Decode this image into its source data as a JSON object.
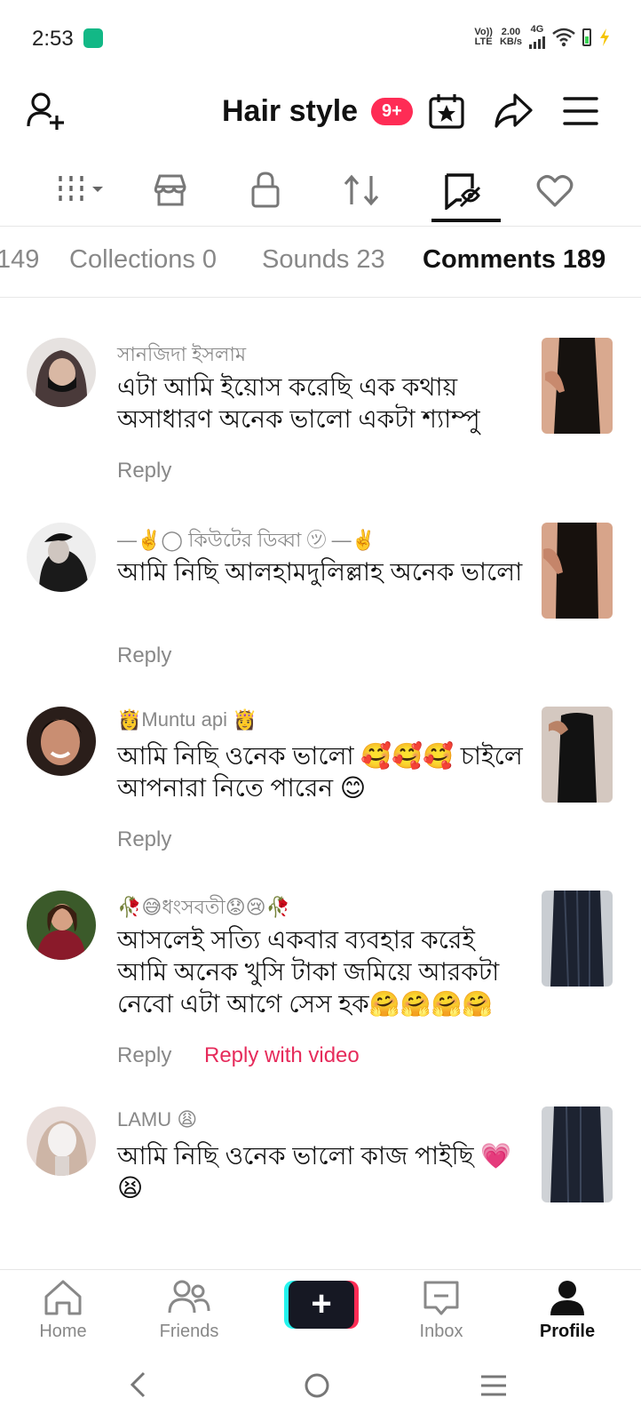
{
  "status": {
    "time": "2:53",
    "net1": "Vo))",
    "net2": "LTE",
    "speed1": "2.00",
    "speed2": "KB/s",
    "gen": "4G"
  },
  "header": {
    "title": "Hair style",
    "badge": "9+"
  },
  "icon_tabs": [
    "grid-dropdown",
    "shop",
    "lock",
    "repost",
    "collections",
    "liked"
  ],
  "sub_tabs": [
    {
      "label": "149"
    },
    {
      "label": "Collections 0"
    },
    {
      "label": "Sounds 23"
    },
    {
      "label": "Comments 189",
      "active": true
    }
  ],
  "comments": [
    {
      "user": "সানজিদা ইসলাম",
      "text": "এটা আমি ইয়োস করেছি এক কথায় অসাধারণ অনেক ভালো একটা শ্যাম্পু",
      "reply": "Reply"
    },
    {
      "user": "—✌️◯ কিউটের ডিব্বা ㋡ —✌️",
      "text": "আমি নিছি আলহামদুলিল্লাহ অনেক ভালো",
      "reply": "Reply"
    },
    {
      "user": "👸Muntu api 👸",
      "text": "আমি নিছি ওনেক ভালো 🥰🥰🥰 চাইলে আপনারা নিতে পারেন 😊",
      "reply": "Reply"
    },
    {
      "user": "🥀😅ধংসবতী😟😢🥀",
      "text": "আসলেই সত্যি একবার ব্যবহার করেই আমি অনেক খুসি টাকা জমিয়ে আরকটা নেবো এটা আগে সেস হক🤗🤗🤗🤗",
      "reply": "Reply",
      "reply_video": "Reply with video"
    },
    {
      "user": "LAMU 😩",
      "text": "আমি নিছি ওনেক ভালো কাজ পাইছি 💗😫",
      "reply": ""
    }
  ],
  "bottom_nav": {
    "home": "Home",
    "friends": "Friends",
    "inbox": "Inbox",
    "profile": "Profile"
  },
  "colors": {
    "accent": "#fe2c55",
    "reply_video": "#e62b5b",
    "muted": "#888888"
  }
}
